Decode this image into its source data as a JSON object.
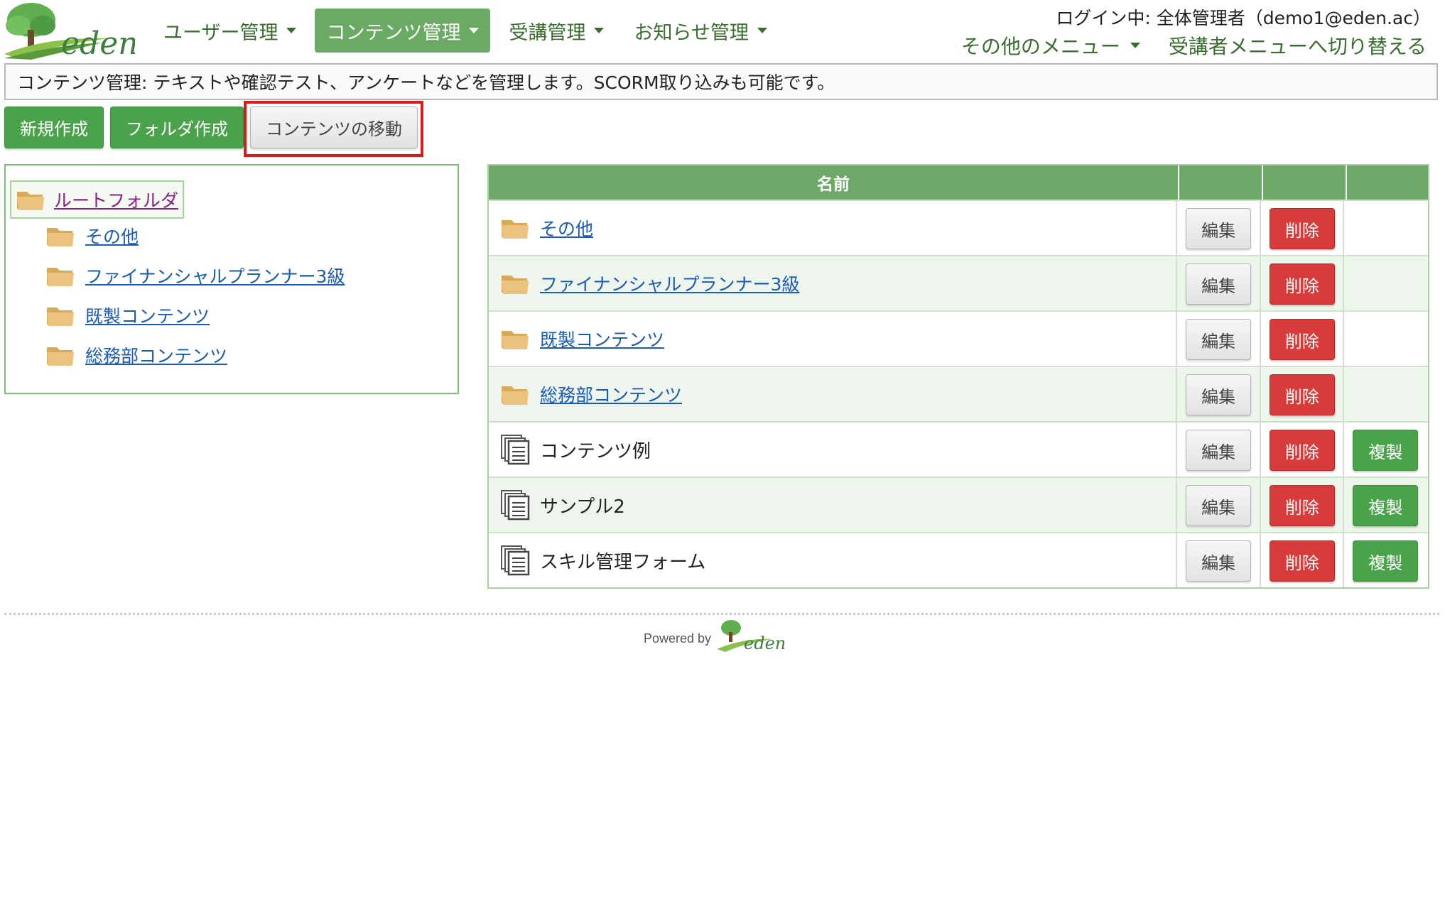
{
  "header": {
    "logo_text": "eden",
    "nav": [
      {
        "label": "ユーザー管理",
        "active": false
      },
      {
        "label": "コンテンツ管理",
        "active": true
      },
      {
        "label": "受講管理",
        "active": false
      },
      {
        "label": "お知らせ管理",
        "active": false
      }
    ],
    "login": "ログイン中: 全体管理者（demo1@eden.ac）",
    "other_menu": "その他のメニュー",
    "switch_menu": "受講者メニューへ切り替える"
  },
  "description": "コンテンツ管理: テキストや確認テスト、アンケートなどを管理します。SCORM取り込みも可能です。",
  "actions": {
    "new": "新規作成",
    "new_folder": "フォルダ作成",
    "move": "コンテンツの移動"
  },
  "tree": {
    "root": "ルートフォルダ",
    "children": [
      "その他",
      "ファイナンシャルプランナー3級",
      "既製コンテンツ",
      "総務部コンテンツ"
    ]
  },
  "table": {
    "header_name": "名前",
    "rows": [
      {
        "name": "その他",
        "type": "folder",
        "edit": "編集",
        "delete": "削除"
      },
      {
        "name": "ファイナンシャルプランナー3級",
        "type": "folder",
        "edit": "編集",
        "delete": "削除"
      },
      {
        "name": "既製コンテンツ",
        "type": "folder",
        "edit": "編集",
        "delete": "削除"
      },
      {
        "name": "総務部コンテンツ",
        "type": "folder",
        "edit": "編集",
        "delete": "削除"
      },
      {
        "name": "コンテンツ例",
        "type": "content",
        "edit": "編集",
        "delete": "削除",
        "copy": "複製"
      },
      {
        "name": "サンプル2",
        "type": "content",
        "edit": "編集",
        "delete": "削除",
        "copy": "複製"
      },
      {
        "name": "スキル管理フォーム",
        "type": "content",
        "edit": "編集",
        "delete": "削除",
        "copy": "複製"
      }
    ]
  },
  "footer": {
    "powered_by": "Powered by",
    "logo_text": "eden"
  },
  "colors": {
    "brand_green": "#4aa24a",
    "nav_active": "#6aaa64",
    "danger": "#d93a3a",
    "highlight": "#e01818"
  }
}
